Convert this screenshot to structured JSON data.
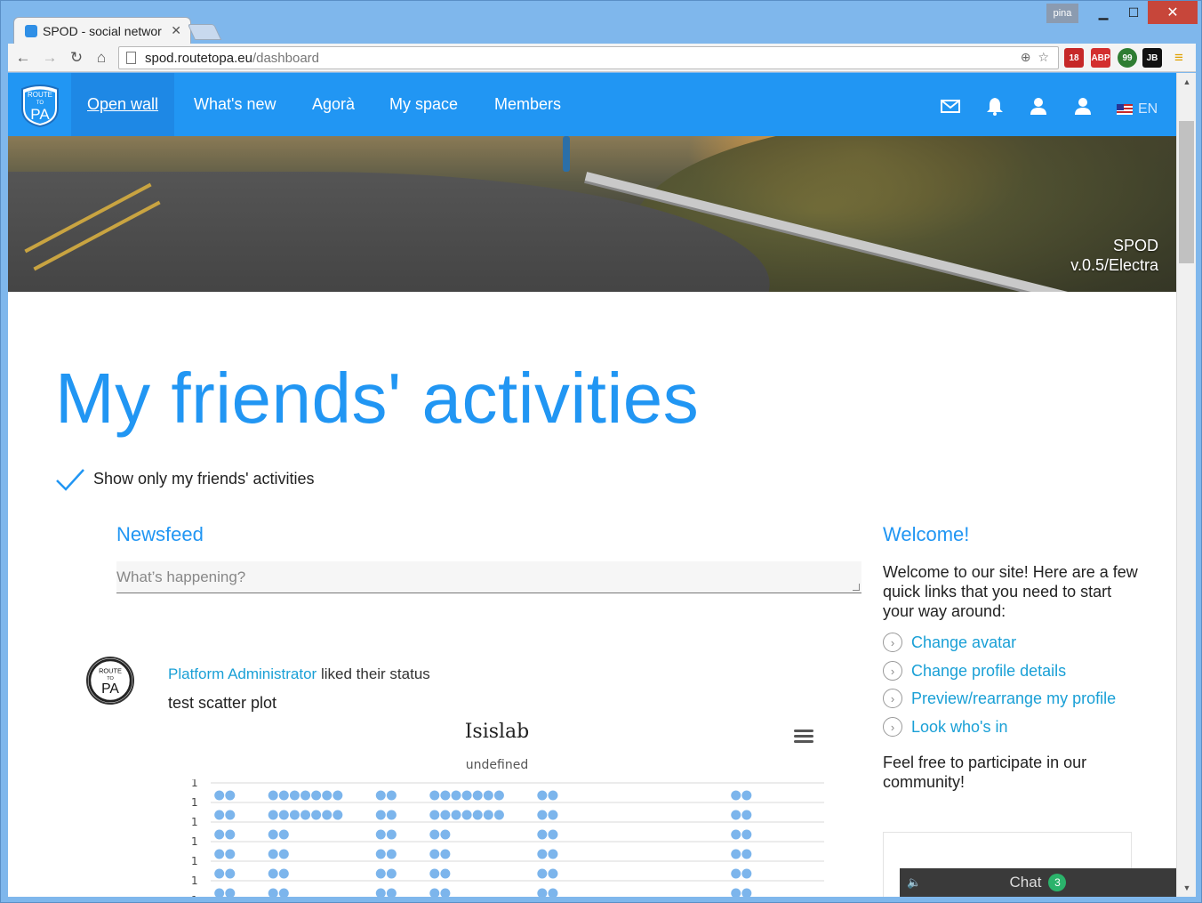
{
  "browser": {
    "tab_title": "SPOD - social networ",
    "tab_close": "✕",
    "user_chip": "pina",
    "url_host": "spod.routetopa.eu",
    "url_path": "/dashboard",
    "extensions": [
      "18",
      "ABP",
      "99",
      "JB"
    ]
  },
  "nav": {
    "logo_top": "ROUTE",
    "logo_to": "TO",
    "logo_pa": "PA",
    "items": [
      "Open wall",
      "What's new",
      "Agorà",
      "My space",
      "Members"
    ],
    "lang": "EN"
  },
  "hero": {
    "app_name": "SPOD",
    "version": "v.0.5/Electra"
  },
  "main": {
    "title": "My friends' activities",
    "filter_label": "Show only my friends' activities",
    "newsfeed_heading": "Newsfeed",
    "newsfeed_placeholder": "What’s happening?"
  },
  "activity": {
    "actor": "Platform Administrator",
    "action": " liked their status",
    "post_text": "test scatter plot"
  },
  "chart_data": {
    "type": "scatter",
    "title": "Isislab",
    "subtitle": "undefined",
    "y_tick_labels": [
      "1",
      "1",
      "1",
      "1",
      "1",
      "1",
      "1"
    ],
    "x_pattern_columns": [
      {
        "x": 1,
        "ys": [
          1,
          2,
          3,
          4,
          5,
          6,
          7
        ]
      },
      {
        "x": 2,
        "ys": [
          1,
          2,
          3,
          4,
          5,
          6,
          7
        ]
      },
      {
        "x": 6,
        "ys": [
          1,
          2,
          3,
          4,
          5,
          6,
          7
        ]
      },
      {
        "x": 7,
        "ys": [
          1,
          2,
          3,
          4,
          5,
          6,
          7
        ]
      },
      {
        "x": 16,
        "ys": [
          1,
          2,
          3,
          4,
          5,
          6,
          7
        ]
      },
      {
        "x": 17,
        "ys": [
          1,
          2,
          3,
          4,
          5,
          6,
          7
        ]
      },
      {
        "x": 21,
        "ys": [
          1,
          2,
          3,
          4,
          5,
          6,
          7
        ]
      },
      {
        "x": 22,
        "ys": [
          1,
          2,
          3,
          4,
          5,
          6,
          7
        ]
      },
      {
        "x": 31,
        "ys": [
          1,
          2,
          3,
          4,
          5,
          6,
          7
        ]
      },
      {
        "x": 32,
        "ys": [
          1,
          2,
          3,
          4,
          5,
          6,
          7
        ]
      },
      {
        "x": 49,
        "ys": [
          1,
          2,
          3,
          4,
          5,
          6,
          7
        ]
      },
      {
        "x": 50,
        "ys": [
          1,
          2,
          3,
          4,
          5,
          6,
          7
        ]
      }
    ],
    "x_top_rows": [
      {
        "from": 8,
        "to": 12
      },
      {
        "from": 23,
        "to": 27
      }
    ],
    "color": "#7cb5ec"
  },
  "sidebar": {
    "heading": "Welcome!",
    "intro": "Welcome to our site! Here are a few quick links that you need to start your way around:",
    "links": [
      "Change avatar",
      "Change profile details",
      "Preview/rearrange my profile",
      "Look who's in"
    ],
    "outro": "Feel free to participate in our community!"
  },
  "chat": {
    "label": "Chat",
    "count": "3"
  },
  "colors": {
    "brand": "#2196f3",
    "link": "#1aa0d6",
    "chat_badge": "#2bb36b"
  }
}
